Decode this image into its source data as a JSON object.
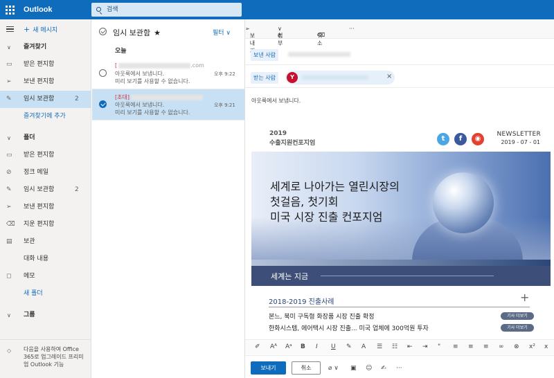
{
  "app": {
    "title": "Outlook",
    "search_placeholder": "검색"
  },
  "nav": {
    "new_mail": "새 메시지",
    "favorites": "즐겨찾기",
    "fav_items": [
      {
        "label": "받은 편지함",
        "icon": "inbox-icon"
      },
      {
        "label": "보낸 편지함",
        "icon": "send-icon"
      },
      {
        "label": "임시 보관함",
        "icon": "pencil-icon",
        "count": "2"
      },
      {
        "label": "즐겨찾기에 추가"
      }
    ],
    "folders": "폴더",
    "folder_items": [
      {
        "label": "받은 편지함",
        "icon": "inbox-icon"
      },
      {
        "label": "정크 메일",
        "icon": "block-icon"
      },
      {
        "label": "임시 보관함",
        "icon": "pencil-icon",
        "count": "2"
      },
      {
        "label": "보낸 편지함",
        "icon": "send-icon"
      },
      {
        "label": "지운 편지함",
        "icon": "trash-icon"
      },
      {
        "label": "보관",
        "icon": "archive-icon"
      },
      {
        "label": "대화 내용"
      },
      {
        "label": "메모",
        "icon": "note-icon"
      },
      {
        "label": "새 폴더"
      }
    ],
    "groups": "그룹",
    "upsell": "다음을 사용하여 Office 365로 업그레이드 프리미엄 Outlook 기능"
  },
  "list": {
    "title": "임시 보관함",
    "filter": "필터",
    "day": "오늘",
    "messages": [
      {
        "from_prefix": "[",
        "from_tail": ".com",
        "time": "오후 9:22",
        "line2": "아웃룩에서 보냅니다.",
        "line3": "미리 보기를 사용할 수 없습니다.",
        "selected": false
      },
      {
        "from_prefix": "[초대]",
        "from_tail": "",
        "time": "오후 9:21",
        "line2": "아웃룩에서 보냅니다.",
        "line3": "미리 보기를 사용할 수 없습니다.",
        "selected": true
      }
    ]
  },
  "compose": {
    "toolbar": {
      "send": "보내기",
      "attach": "첨부",
      "discard": "취소",
      "more": "···"
    },
    "from_label": "보낸 사람",
    "to_label": "받는 사람",
    "avatar_letter": "Y",
    "body": "아웃룩에서 보냅니다.",
    "send_button": "보내기",
    "cancel_button": "취소"
  },
  "newsletter": {
    "year": "2019",
    "org": "수출지원컨포지엄",
    "label": "NEWSLETTER",
    "date": "2019 - 07 - 01",
    "hero_lines": [
      "세계로 나아가는 열린시장의",
      "첫걸음, 첫기회",
      "미국 시장 진출 컨포지엄"
    ],
    "band": "세계는 지금",
    "section": "2018-2019 진출사례",
    "articles": [
      {
        "text": "본느, 북미 구독형 화장품 시장 진출 확정",
        "btn": "기사 더보기"
      },
      {
        "text": "한화시스템, 에어택시 시장 진출... 미국 업체에 300억원 투자",
        "btn": "기사 더보기"
      }
    ]
  }
}
